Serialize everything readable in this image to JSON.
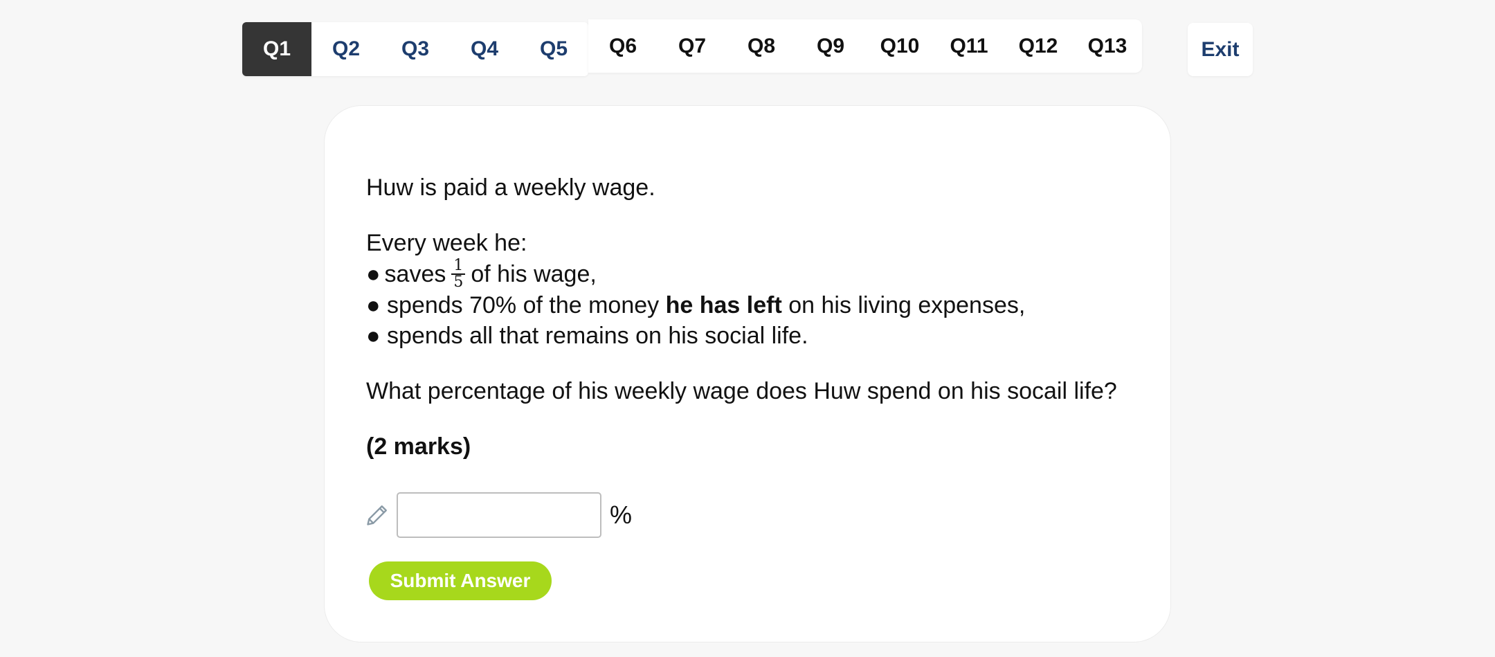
{
  "nav": {
    "left_tabs": [
      {
        "label": "Q1",
        "active": true
      },
      {
        "label": "Q2"
      },
      {
        "label": "Q3"
      },
      {
        "label": "Q4"
      },
      {
        "label": "Q5"
      }
    ],
    "right_tabs": [
      {
        "label": "Q6"
      },
      {
        "label": "Q7"
      },
      {
        "label": "Q8"
      },
      {
        "label": "Q9"
      },
      {
        "label": "Q10"
      },
      {
        "label": "Q11"
      },
      {
        "label": "Q12"
      },
      {
        "label": "Q13"
      }
    ],
    "exit_label": "Exit"
  },
  "question": {
    "intro": "Huw is paid a weekly wage.",
    "list_heading": "Every week he:",
    "bullet_symbol": "●",
    "bullet1": {
      "before": "saves",
      "fraction": {
        "numerator": "1",
        "denominator": "5"
      },
      "after": "of his wage,"
    },
    "bullet2": {
      "before": "spends 70% of the money",
      "bold": "he has left",
      "after": "on his living expenses,"
    },
    "bullet3": "spends all that remains on his social life.",
    "prompt": "What percentage of his weekly wage does Huw spend on his socail life?",
    "marks": "(2 marks)"
  },
  "answer": {
    "value": "",
    "placeholder": "",
    "unit": "%",
    "icon": "pencil-icon"
  },
  "submit_label": "Submit Answer",
  "colors": {
    "active_tab_bg": "#353535",
    "link_blue": "#1d3d6e",
    "submit_green": "#a7d81c",
    "page_bg": "#f7f7f7"
  }
}
